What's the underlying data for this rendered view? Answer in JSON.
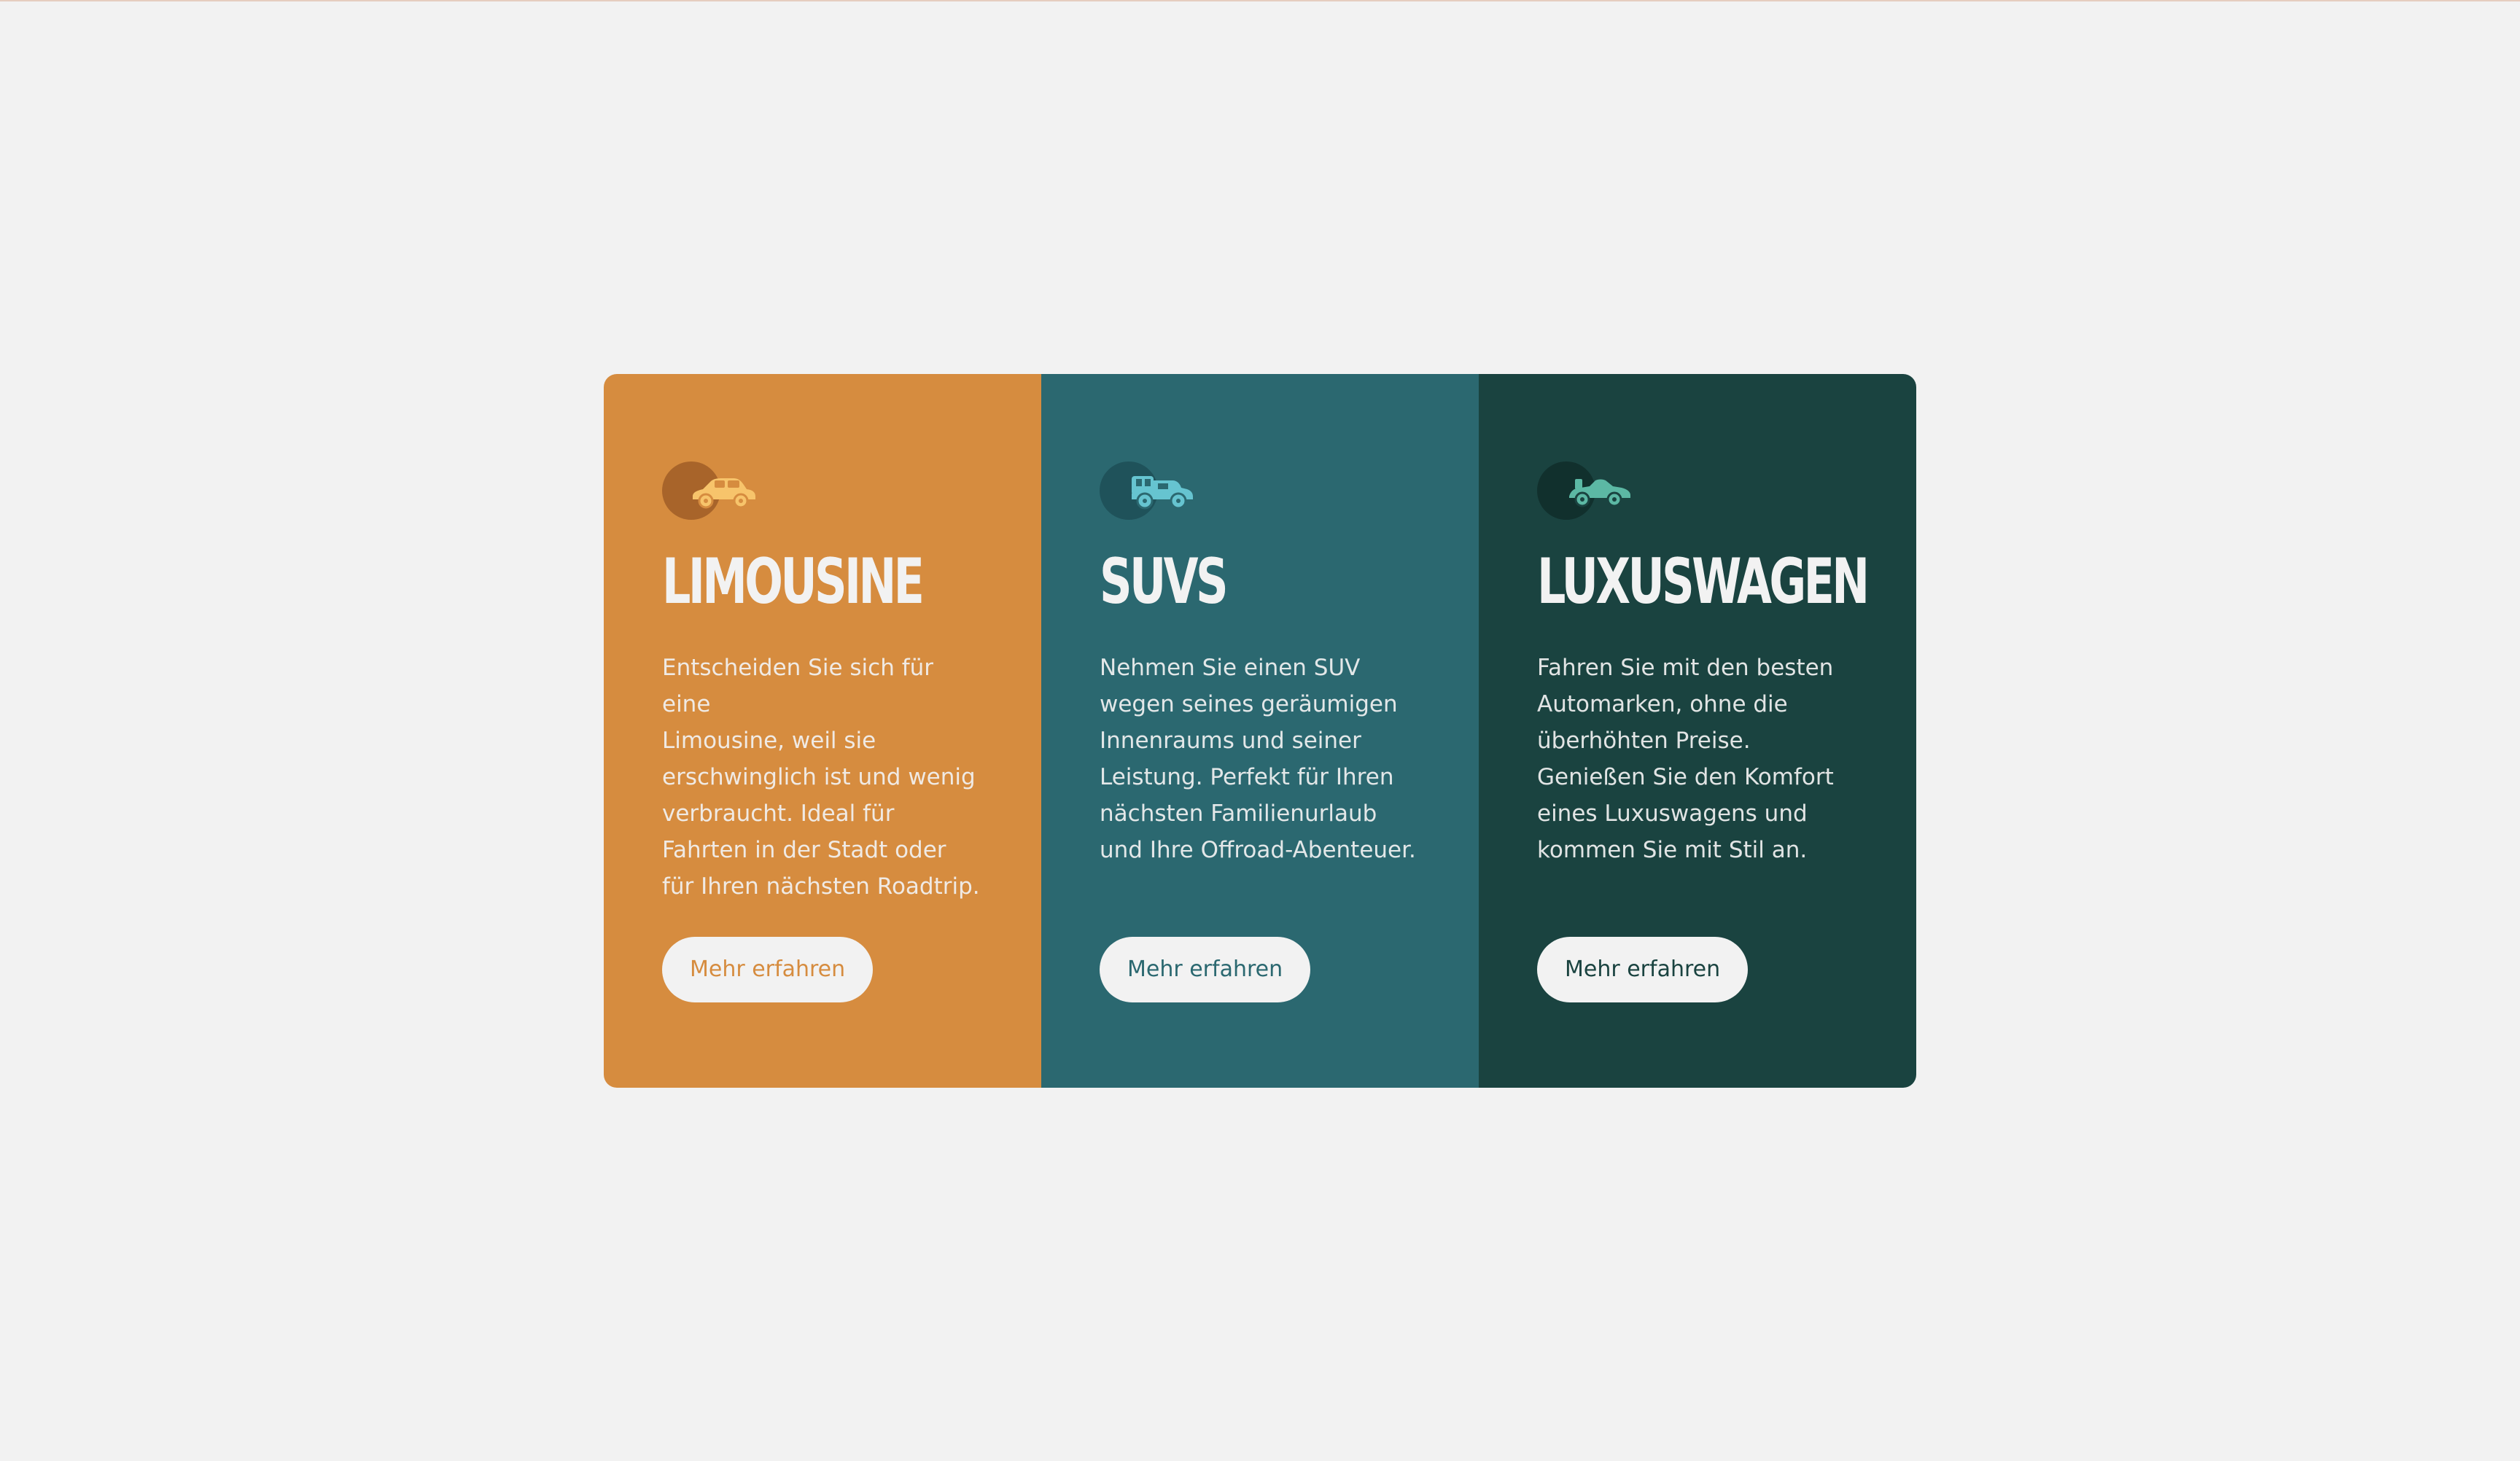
{
  "colors": {
    "background": "#f2f2f2",
    "sedans": "#d68c3f",
    "suvs": "#2b6870",
    "luxury": "#1a4340",
    "sedans_icon": "#f7c46b",
    "suvs_icon": "#66c4d0",
    "luxury_icon": "#5cb8a4"
  },
  "cards": [
    {
      "icon": "sedan-car-icon",
      "title": "LIMOUSINE",
      "text": "Entscheiden Sie sich für eine\nLimousine, weil sie\nerschwinglich ist und wenig\nverbraucht. Ideal für\nFahrten in der Stadt oder\nfür Ihren nächsten Roadtrip.",
      "button": "Mehr erfahren"
    },
    {
      "icon": "suv-icon",
      "title": "SUVS",
      "text": "Nehmen Sie einen SUV\nwegen seines geräumigen\nInnenraums und seiner\nLeistung. Perfekt für Ihren\nnächsten Familienurlaub\nund Ihre Offroad-Abenteuer.",
      "button": "Mehr erfahren"
    },
    {
      "icon": "luxury-car-icon",
      "title": "LUXUSWAGEN",
      "text": "Fahren Sie mit den besten\nAutomarken, ohne die\nüberhöhten Preise.\nGenießen Sie den Komfort\neines Luxuswagens und\nkommen Sie mit Stil an.",
      "button": "Mehr erfahren"
    }
  ]
}
